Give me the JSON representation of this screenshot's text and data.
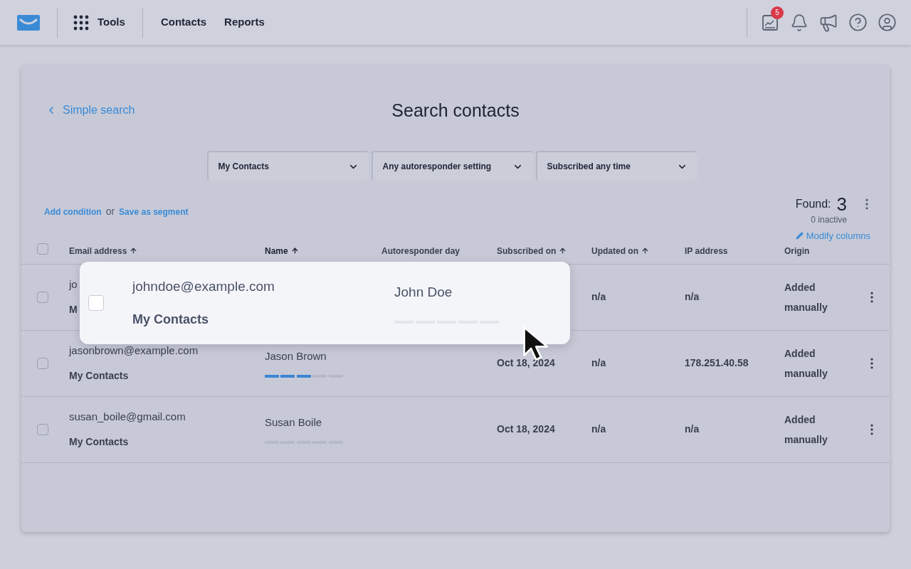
{
  "nav": {
    "apps_label": "Tools",
    "links": [
      "Contacts",
      "Reports"
    ],
    "notification_count": "5"
  },
  "search": {
    "back_link": "Simple search",
    "title": "Search contacts",
    "filters": [
      "My Contacts",
      "Any autoresponder setting",
      "Subscribed any time"
    ],
    "add_condition": "Add condition",
    "or": "or",
    "save_segment": "Save as segment",
    "found_label": "Found:",
    "found_count": "3",
    "inactive": "0 inactive",
    "modify_columns": "Modify columns"
  },
  "table": {
    "all_checked": false,
    "columns": [
      {
        "label": "Email address",
        "sorted": true
      },
      {
        "label": "Name",
        "sorted": true
      },
      {
        "label": "Autoresponder day",
        "sorted": false
      },
      {
        "label": "Subscribed on",
        "sorted": true
      },
      {
        "label": "Updated on",
        "sorted": true
      },
      {
        "label": "IP address",
        "sorted": false
      },
      {
        "label": "Origin",
        "sorted": false
      }
    ],
    "rows": [
      {
        "checked": false,
        "email": "jo",
        "list": "M",
        "updated": "n/a",
        "ip": "n/a",
        "origin": "Added manually"
      },
      {
        "checked": false,
        "email": "jasonbrown@example.com",
        "list": "My Contacts",
        "name": "Jason Brown",
        "level": 0.6,
        "subscribed": "Oct 18, 2024",
        "updated": "n/a",
        "ip": "178.251.40.58",
        "origin": "Added manually"
      },
      {
        "checked": false,
        "email": "susan_boile@gmail.com",
        "list": "My Contacts",
        "name": "Susan Boile",
        "level": 0,
        "subscribed": "Oct 18, 2024",
        "updated": "n/a",
        "ip": "n/a",
        "origin": "Added manually"
      }
    ]
  },
  "hover_card": {
    "checked": false,
    "email": "johndoe@example.com",
    "list": "My Contacts",
    "name": "John Doe",
    "level": 0
  }
}
